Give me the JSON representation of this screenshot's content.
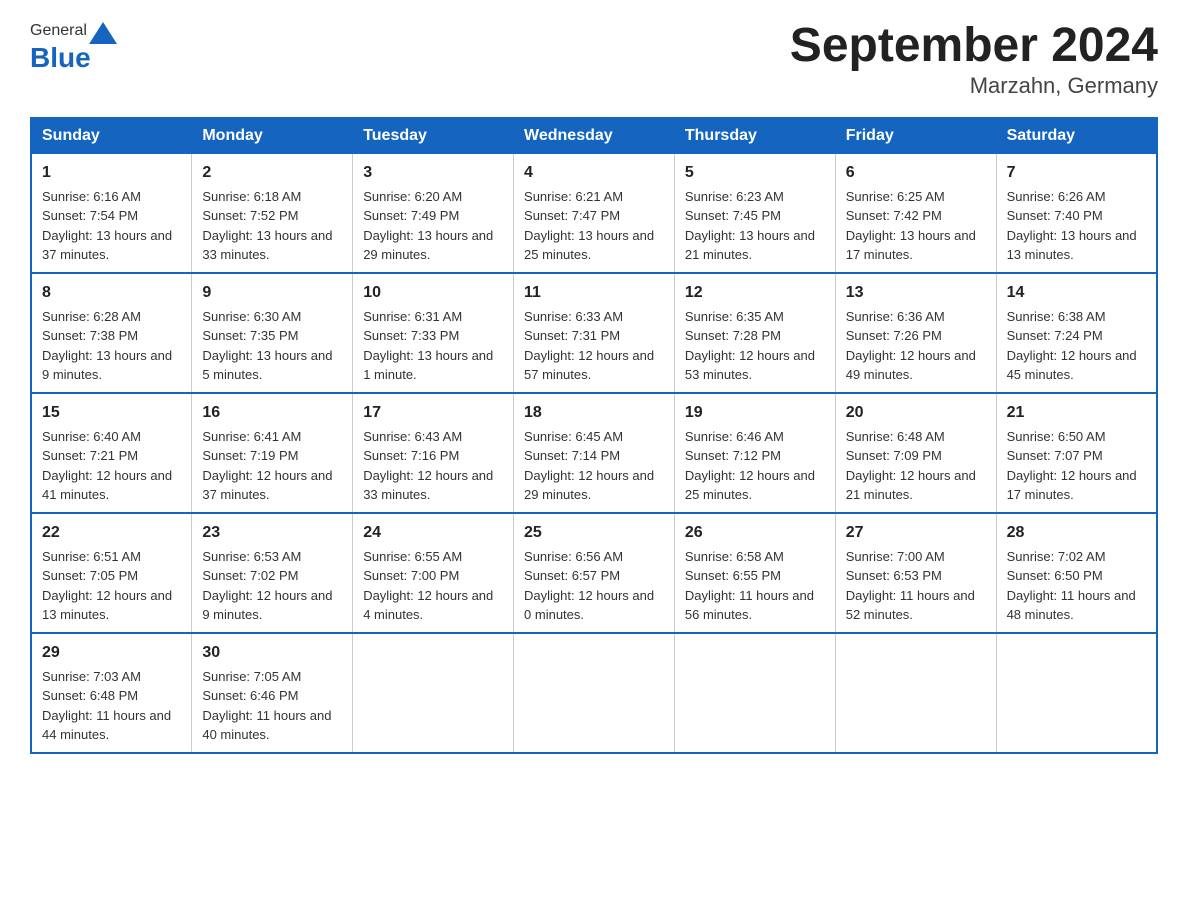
{
  "header": {
    "title": "September 2024",
    "location": "Marzahn, Germany",
    "logo_general": "General",
    "logo_blue": "Blue"
  },
  "days_of_week": [
    "Sunday",
    "Monday",
    "Tuesday",
    "Wednesday",
    "Thursday",
    "Friday",
    "Saturday"
  ],
  "weeks": [
    [
      {
        "day": "1",
        "sunrise": "6:16 AM",
        "sunset": "7:54 PM",
        "daylight": "13 hours and 37 minutes."
      },
      {
        "day": "2",
        "sunrise": "6:18 AM",
        "sunset": "7:52 PM",
        "daylight": "13 hours and 33 minutes."
      },
      {
        "day": "3",
        "sunrise": "6:20 AM",
        "sunset": "7:49 PM",
        "daylight": "13 hours and 29 minutes."
      },
      {
        "day": "4",
        "sunrise": "6:21 AM",
        "sunset": "7:47 PM",
        "daylight": "13 hours and 25 minutes."
      },
      {
        "day": "5",
        "sunrise": "6:23 AM",
        "sunset": "7:45 PM",
        "daylight": "13 hours and 21 minutes."
      },
      {
        "day": "6",
        "sunrise": "6:25 AM",
        "sunset": "7:42 PM",
        "daylight": "13 hours and 17 minutes."
      },
      {
        "day": "7",
        "sunrise": "6:26 AM",
        "sunset": "7:40 PM",
        "daylight": "13 hours and 13 minutes."
      }
    ],
    [
      {
        "day": "8",
        "sunrise": "6:28 AM",
        "sunset": "7:38 PM",
        "daylight": "13 hours and 9 minutes."
      },
      {
        "day": "9",
        "sunrise": "6:30 AM",
        "sunset": "7:35 PM",
        "daylight": "13 hours and 5 minutes."
      },
      {
        "day": "10",
        "sunrise": "6:31 AM",
        "sunset": "7:33 PM",
        "daylight": "13 hours and 1 minute."
      },
      {
        "day": "11",
        "sunrise": "6:33 AM",
        "sunset": "7:31 PM",
        "daylight": "12 hours and 57 minutes."
      },
      {
        "day": "12",
        "sunrise": "6:35 AM",
        "sunset": "7:28 PM",
        "daylight": "12 hours and 53 minutes."
      },
      {
        "day": "13",
        "sunrise": "6:36 AM",
        "sunset": "7:26 PM",
        "daylight": "12 hours and 49 minutes."
      },
      {
        "day": "14",
        "sunrise": "6:38 AM",
        "sunset": "7:24 PM",
        "daylight": "12 hours and 45 minutes."
      }
    ],
    [
      {
        "day": "15",
        "sunrise": "6:40 AM",
        "sunset": "7:21 PM",
        "daylight": "12 hours and 41 minutes."
      },
      {
        "day": "16",
        "sunrise": "6:41 AM",
        "sunset": "7:19 PM",
        "daylight": "12 hours and 37 minutes."
      },
      {
        "day": "17",
        "sunrise": "6:43 AM",
        "sunset": "7:16 PM",
        "daylight": "12 hours and 33 minutes."
      },
      {
        "day": "18",
        "sunrise": "6:45 AM",
        "sunset": "7:14 PM",
        "daylight": "12 hours and 29 minutes."
      },
      {
        "day": "19",
        "sunrise": "6:46 AM",
        "sunset": "7:12 PM",
        "daylight": "12 hours and 25 minutes."
      },
      {
        "day": "20",
        "sunrise": "6:48 AM",
        "sunset": "7:09 PM",
        "daylight": "12 hours and 21 minutes."
      },
      {
        "day": "21",
        "sunrise": "6:50 AM",
        "sunset": "7:07 PM",
        "daylight": "12 hours and 17 minutes."
      }
    ],
    [
      {
        "day": "22",
        "sunrise": "6:51 AM",
        "sunset": "7:05 PM",
        "daylight": "12 hours and 13 minutes."
      },
      {
        "day": "23",
        "sunrise": "6:53 AM",
        "sunset": "7:02 PM",
        "daylight": "12 hours and 9 minutes."
      },
      {
        "day": "24",
        "sunrise": "6:55 AM",
        "sunset": "7:00 PM",
        "daylight": "12 hours and 4 minutes."
      },
      {
        "day": "25",
        "sunrise": "6:56 AM",
        "sunset": "6:57 PM",
        "daylight": "12 hours and 0 minutes."
      },
      {
        "day": "26",
        "sunrise": "6:58 AM",
        "sunset": "6:55 PM",
        "daylight": "11 hours and 56 minutes."
      },
      {
        "day": "27",
        "sunrise": "7:00 AM",
        "sunset": "6:53 PM",
        "daylight": "11 hours and 52 minutes."
      },
      {
        "day": "28",
        "sunrise": "7:02 AM",
        "sunset": "6:50 PM",
        "daylight": "11 hours and 48 minutes."
      }
    ],
    [
      {
        "day": "29",
        "sunrise": "7:03 AM",
        "sunset": "6:48 PM",
        "daylight": "11 hours and 44 minutes."
      },
      {
        "day": "30",
        "sunrise": "7:05 AM",
        "sunset": "6:46 PM",
        "daylight": "11 hours and 40 minutes."
      },
      null,
      null,
      null,
      null,
      null
    ]
  ],
  "labels": {
    "sunrise": "Sunrise:",
    "sunset": "Sunset:",
    "daylight": "Daylight:"
  }
}
